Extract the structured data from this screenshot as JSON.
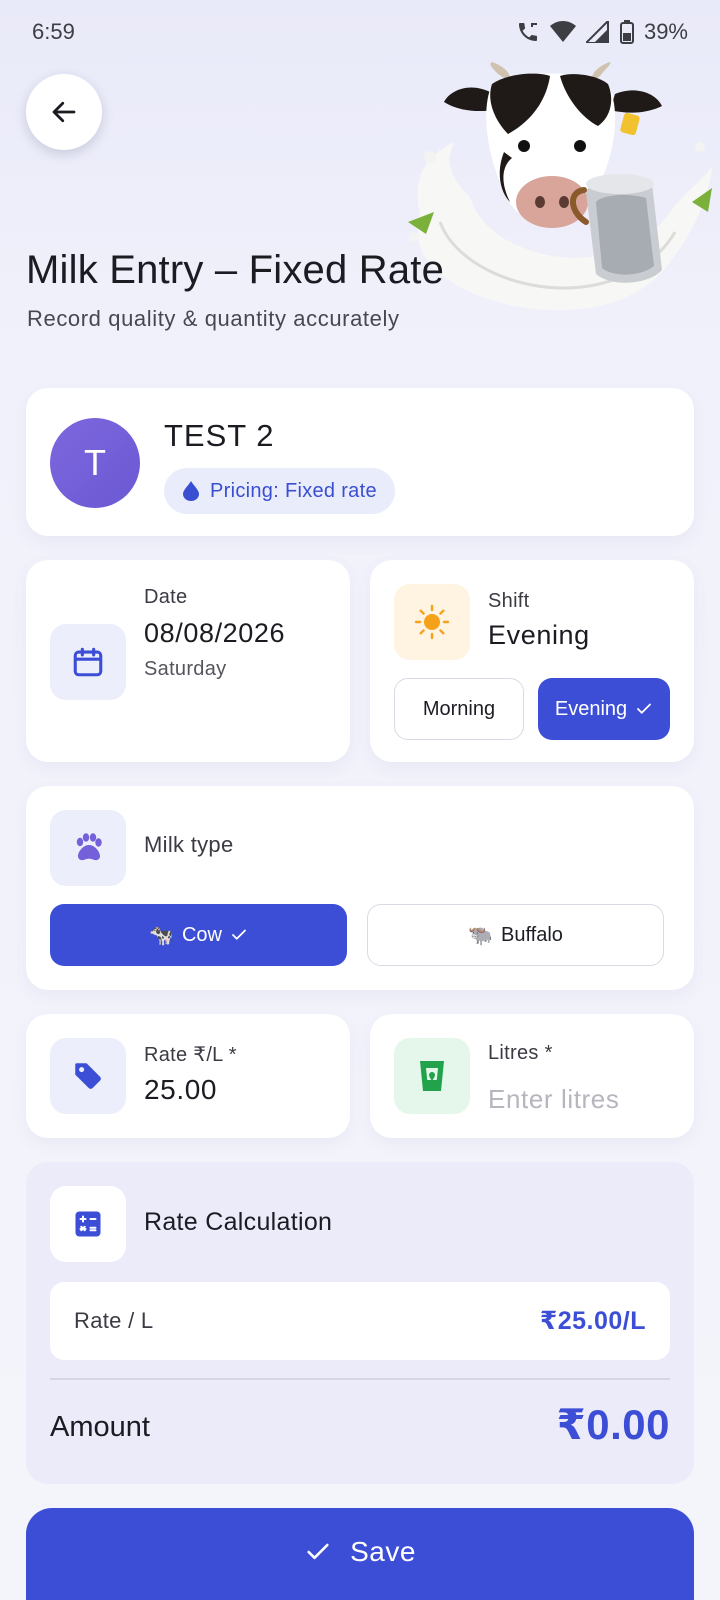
{
  "status_bar": {
    "time": "6:59",
    "battery": "39%"
  },
  "header": {
    "title": "Milk Entry – Fixed Rate",
    "subtitle": "Record quality & quantity accurately"
  },
  "farmer": {
    "initial": "T",
    "name": "TEST 2",
    "pricing_label": "Pricing: Fixed rate"
  },
  "date": {
    "label": "Date",
    "value": "08/08/2026",
    "weekday": "Saturday"
  },
  "shift": {
    "label": "Shift",
    "value": "Evening",
    "options": [
      "Morning",
      "Evening"
    ],
    "selected": "Evening"
  },
  "milk_type": {
    "label": "Milk type",
    "options": [
      {
        "label": "Cow",
        "emoji": "🐄"
      },
      {
        "label": "Buffalo",
        "emoji": "🐃"
      }
    ],
    "selected": "Cow"
  },
  "rate": {
    "label": "Rate ₹/L *",
    "value": "25.00"
  },
  "litres": {
    "label": "Litres *",
    "value": "",
    "placeholder": "Enter litres"
  },
  "calculation": {
    "title": "Rate Calculation",
    "rate_label": "Rate / L",
    "rate_value": "₹25.00/L",
    "amount_label": "Amount",
    "amount_value": "₹0.00"
  },
  "save_label": "Save",
  "colors": {
    "primary": "#3d4ed6",
    "avatar": "#7461da",
    "green": "#22a24a",
    "orange": "#f5a21a"
  }
}
